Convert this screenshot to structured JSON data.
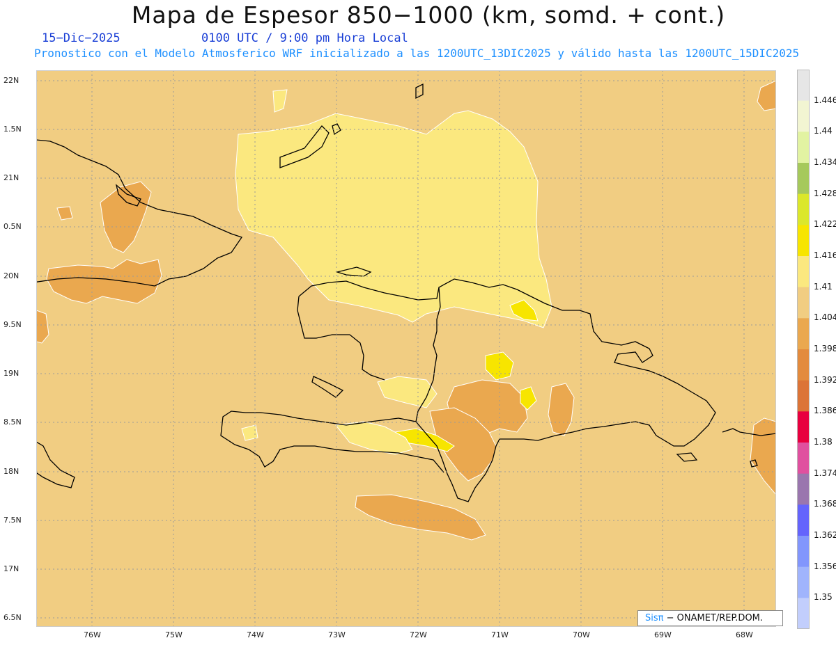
{
  "header": {
    "title": "Mapa de Espesor 850−1000 (km, somd. + cont.)",
    "date": "15−Dic−2025",
    "time": "0100 UTC / 9:00 pm Hora Local",
    "forecast_note": "Pronostico con el Modelo Atmosferico WRF inicializado a las 1200UTC_13DIC2025 y válido hasta las  1200UTC_15DIC2025"
  },
  "map": {
    "lat_labels": [
      "22N",
      "1.5N",
      "21N",
      "0.5N",
      "20N",
      "9.5N",
      "19N",
      "8.5N",
      "18N",
      "7.5N",
      "17N",
      "6.5N"
    ],
    "lon_labels": [
      "76W",
      "75W",
      "74W",
      "73W",
      "72W",
      "71W",
      "70W",
      "69W",
      "68W"
    ],
    "background_color": "#f1cd82",
    "grid": "dotted"
  },
  "colorbar": {
    "labels": [
      "1.446",
      "1.44",
      "1.434",
      "1.428",
      "1.422",
      "1.416",
      "1.41",
      "1.404",
      "1.398",
      "1.392",
      "1.386",
      "1.38",
      "1.374",
      "1.368",
      "1.362",
      "1.356",
      "1.35"
    ],
    "colors": [
      "#e6e6e6",
      "#f2f5d2",
      "#e2f3a2",
      "#a6c95c",
      "#dbe72b",
      "#f7e500",
      "#fbe87f",
      "#f1cd82",
      "#eaa84f",
      "#e38b3d",
      "#dc7437",
      "#e8003f",
      "#e0509f",
      "#9a76ae",
      "#6464fc",
      "#8296fc",
      "#a0b4fc",
      "#c2cefc"
    ]
  },
  "credit": {
    "sis": "Sisπ",
    "text": "− ONAMET/REP.DOM."
  }
}
